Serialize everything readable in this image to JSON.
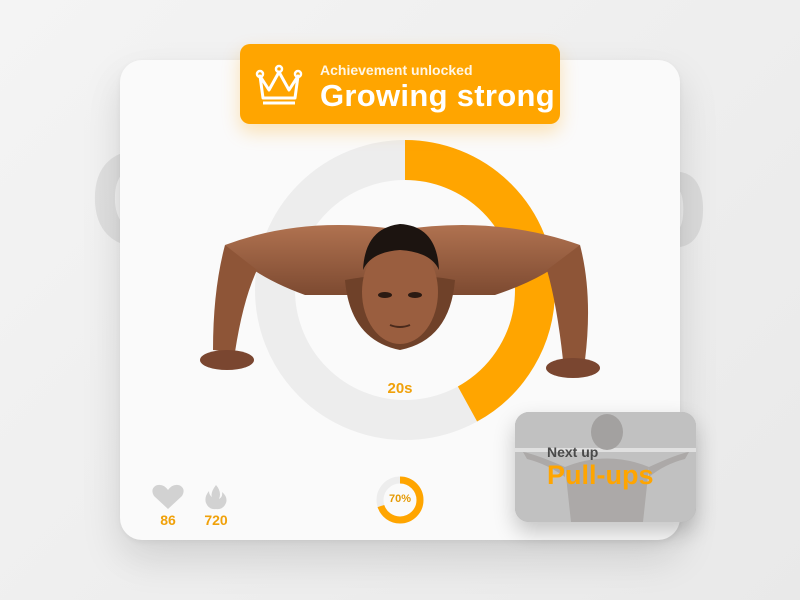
{
  "background_text": "Good job",
  "achievement": {
    "subtitle": "Achievement unlocked",
    "title": "Growing strong",
    "icon": "crown-icon"
  },
  "exercise": {
    "timer": "20s",
    "progress": 0.42
  },
  "stats": {
    "heart_rate": "86",
    "calories": "720"
  },
  "completion": {
    "label": "70%",
    "value": 0.7
  },
  "next_up": {
    "label": "Next up",
    "title": "Pull-ups"
  },
  "colors": {
    "accent": "#ffa500",
    "ring_track": "#ededed",
    "icon_gray": "#d2d2d2"
  }
}
